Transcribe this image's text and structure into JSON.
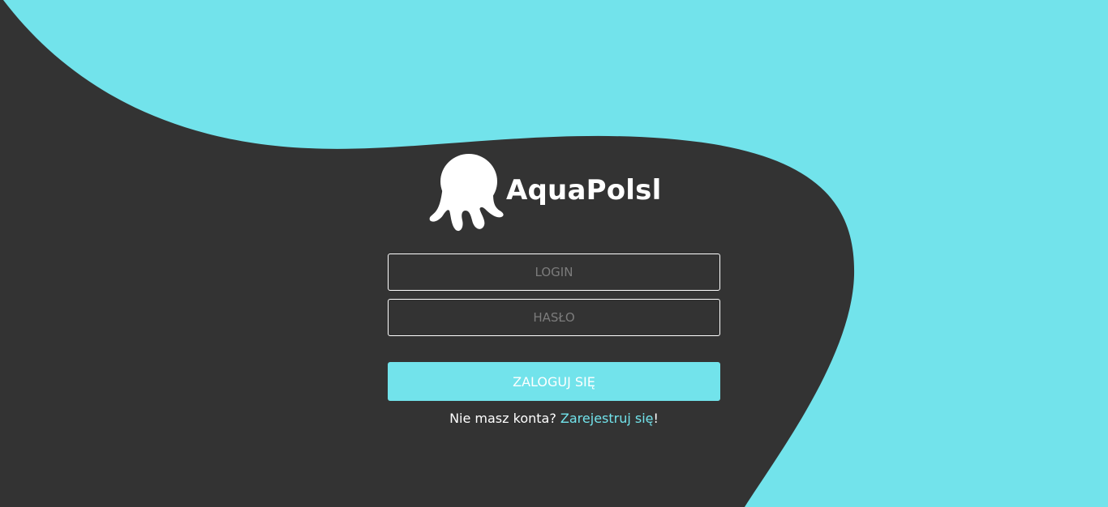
{
  "colors": {
    "accent": "#72e3eb",
    "dark": "#333333",
    "text": "#ffffff",
    "placeholder": "#7c7c7c"
  },
  "brand": {
    "icon": "octopus-icon",
    "name": "AquaPolsl"
  },
  "form": {
    "login": {
      "value": "",
      "placeholder": "LOGIN"
    },
    "password": {
      "value": "",
      "placeholder": "HASŁO"
    },
    "submit_label": "ZALOGUJ SIĘ"
  },
  "register": {
    "prompt": "Nie masz konta?",
    "link_label": "Zarejestruj się",
    "suffix": "!"
  }
}
